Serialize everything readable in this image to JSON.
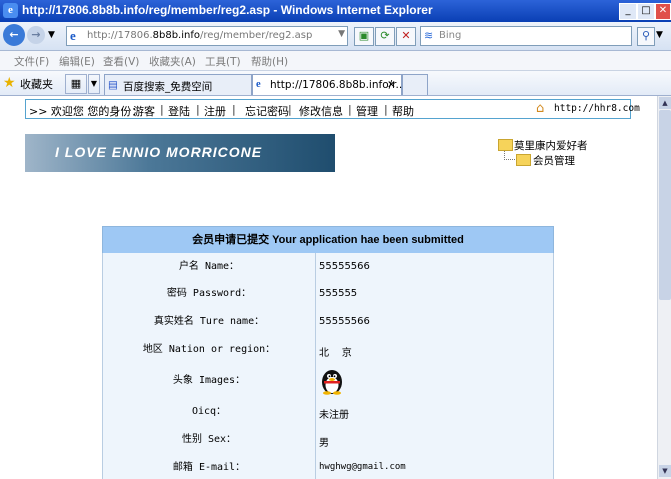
{
  "window": {
    "title": "http://17806.8b8b.info/reg/member/reg2.asp - Windows Internet Explorer"
  },
  "address_bar": {
    "prefix": "http://17806.",
    "host": "8b8b.info",
    "path": "/reg/member/reg2.asp"
  },
  "search": {
    "placeholder": "Bing"
  },
  "menu": [
    "文件(F)",
    "编辑(E)",
    "查看(V)",
    "收藏夹(A)",
    "工具(T)",
    "帮助(H)"
  ],
  "favorites": {
    "label": "收藏夹"
  },
  "tabs": [
    {
      "label": "百度搜索_免费空间"
    },
    {
      "label": "http://17806.8b8b.info/r..."
    }
  ],
  "page": {
    "topnav": {
      "welcome": ">> 欢迎您 您的身份：",
      "guest": "游客",
      "login": "登陆",
      "register": "注册",
      "forgot": "忘记密码",
      "edit": "修改信息",
      "manage": "管理",
      "help": "帮助",
      "site": "http://hhr8.com"
    },
    "banner": "I LOVE ENNIO MORRICONE",
    "tree": {
      "root": "莫里康内爱好者",
      "child": "会员管理"
    },
    "form": {
      "header": "会员申请已提交  Your application hae been submitted",
      "rows": [
        {
          "label": "户名 Name：",
          "value": "55555566"
        },
        {
          "label": "密码 Password：",
          "value": "555555"
        },
        {
          "label": "真实姓名 Ture name：",
          "value": "55555566"
        },
        {
          "label": "地区 Nation or region：",
          "value": "北    京"
        },
        {
          "label": "头象 Images：",
          "value": ""
        },
        {
          "label": "Oicq：",
          "value": "未注册"
        },
        {
          "label": "性别 Sex：",
          "value": "男"
        },
        {
          "label": "邮箱 E-mail：",
          "value": "hwghwg@gmail.com"
        }
      ]
    }
  },
  "colors": {
    "title_bar": "#0a3fb4",
    "form_header": "#9ec8f4",
    "row_bg": "#eef5fc",
    "nav_border": "#55a3cf"
  }
}
